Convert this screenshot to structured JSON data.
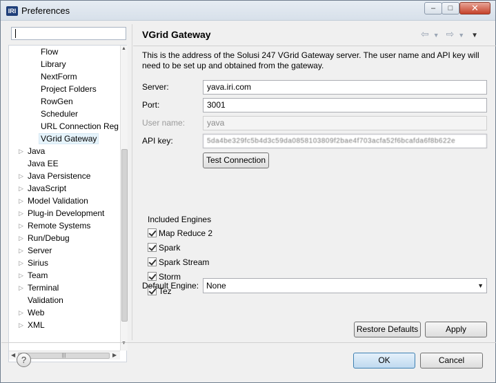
{
  "window": {
    "title": "Preferences",
    "app_icon_text": "IRI",
    "minimize_glyph": "–",
    "maximize_glyph": "□",
    "close_glyph": "✕"
  },
  "tree": {
    "filter_value": "",
    "items": [
      {
        "label": "Flow",
        "level": 2,
        "expandable": false
      },
      {
        "label": "Library",
        "level": 2,
        "expandable": false
      },
      {
        "label": "NextForm",
        "level": 2,
        "expandable": false
      },
      {
        "label": "Project Folders",
        "level": 2,
        "expandable": false
      },
      {
        "label": "RowGen",
        "level": 2,
        "expandable": false
      },
      {
        "label": "Scheduler",
        "level": 2,
        "expandable": false
      },
      {
        "label": "URL Connection Reg",
        "level": 2,
        "expandable": false
      },
      {
        "label": "VGrid Gateway",
        "level": 2,
        "expandable": false,
        "selected": true
      },
      {
        "label": "Java",
        "level": 1,
        "expandable": true
      },
      {
        "label": "Java EE",
        "level": 1,
        "expandable": false
      },
      {
        "label": "Java Persistence",
        "level": 1,
        "expandable": true
      },
      {
        "label": "JavaScript",
        "level": 1,
        "expandable": true
      },
      {
        "label": "Model Validation",
        "level": 1,
        "expandable": true
      },
      {
        "label": "Plug-in Development",
        "level": 1,
        "expandable": true
      },
      {
        "label": "Remote Systems",
        "level": 1,
        "expandable": true
      },
      {
        "label": "Run/Debug",
        "level": 1,
        "expandable": true
      },
      {
        "label": "Server",
        "level": 1,
        "expandable": true
      },
      {
        "label": "Sirius",
        "level": 1,
        "expandable": true
      },
      {
        "label": "Team",
        "level": 1,
        "expandable": true
      },
      {
        "label": "Terminal",
        "level": 1,
        "expandable": true
      },
      {
        "label": "Validation",
        "level": 1,
        "expandable": false
      },
      {
        "label": "Web",
        "level": 1,
        "expandable": true
      },
      {
        "label": "XML",
        "level": 1,
        "expandable": true
      }
    ]
  },
  "page": {
    "title": "VGrid Gateway",
    "description": "This is the address of the Solusi 247 VGrid Gateway server. The user name and API key will need to be set up and obtained from the gateway.",
    "server_label": "Server:",
    "server_value": "yava.iri.com",
    "port_label": "Port:",
    "port_value": "3001",
    "username_label": "User name:",
    "username_value": "yava",
    "apikey_label": "API key:",
    "apikey_value": "5da4be329fc5b4d3c59da0858103809f2bae4f703acfa52f6bcafda6f8b622e",
    "test_connection": "Test Connection",
    "engines_group_label": "Included Engines",
    "engines": [
      {
        "label": "Map Reduce 2",
        "checked": true
      },
      {
        "label": "Spark",
        "checked": true
      },
      {
        "label": "Spark Stream",
        "checked": true
      },
      {
        "label": "Storm",
        "checked": true
      },
      {
        "label": "Tez",
        "checked": true
      }
    ],
    "default_engine_label": "Default Engine:",
    "default_engine_value": "None",
    "restore_defaults": "Restore Defaults",
    "apply": "Apply"
  },
  "dialog": {
    "ok": "OK",
    "cancel": "Cancel",
    "help_glyph": "?"
  }
}
